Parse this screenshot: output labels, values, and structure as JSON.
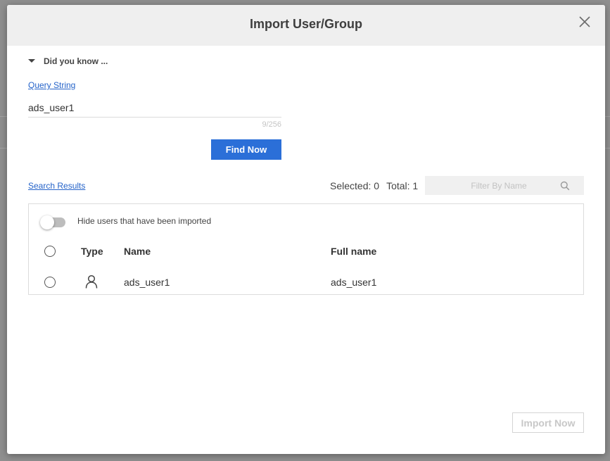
{
  "dialog": {
    "title": "Import User/Group"
  },
  "did_you_know": {
    "label": "Did you know ..."
  },
  "query": {
    "label": "Query String",
    "value": "ads_user1",
    "counter": "9/256"
  },
  "find_button": {
    "label": "Find Now"
  },
  "results": {
    "label": "Search Results",
    "selected_text": "Selected: 0",
    "total_text": "Total: 1",
    "filter_placeholder": "Filter By Name"
  },
  "panel": {
    "toggle_label": "Hide users that have been imported",
    "toggle_on": false,
    "columns": {
      "type": "Type",
      "name": "Name",
      "full_name": "Full name"
    },
    "rows": [
      {
        "type_icon": "user-icon",
        "name": "ads_user1",
        "full_name": "ads_user1",
        "selected": false
      }
    ]
  },
  "import_button": {
    "label": "Import Now",
    "disabled": true
  },
  "colors": {
    "accent": "#2b6fd8",
    "link": "#2563c9",
    "overlay": "#8f8f8f",
    "header_bg": "#efefef"
  }
}
